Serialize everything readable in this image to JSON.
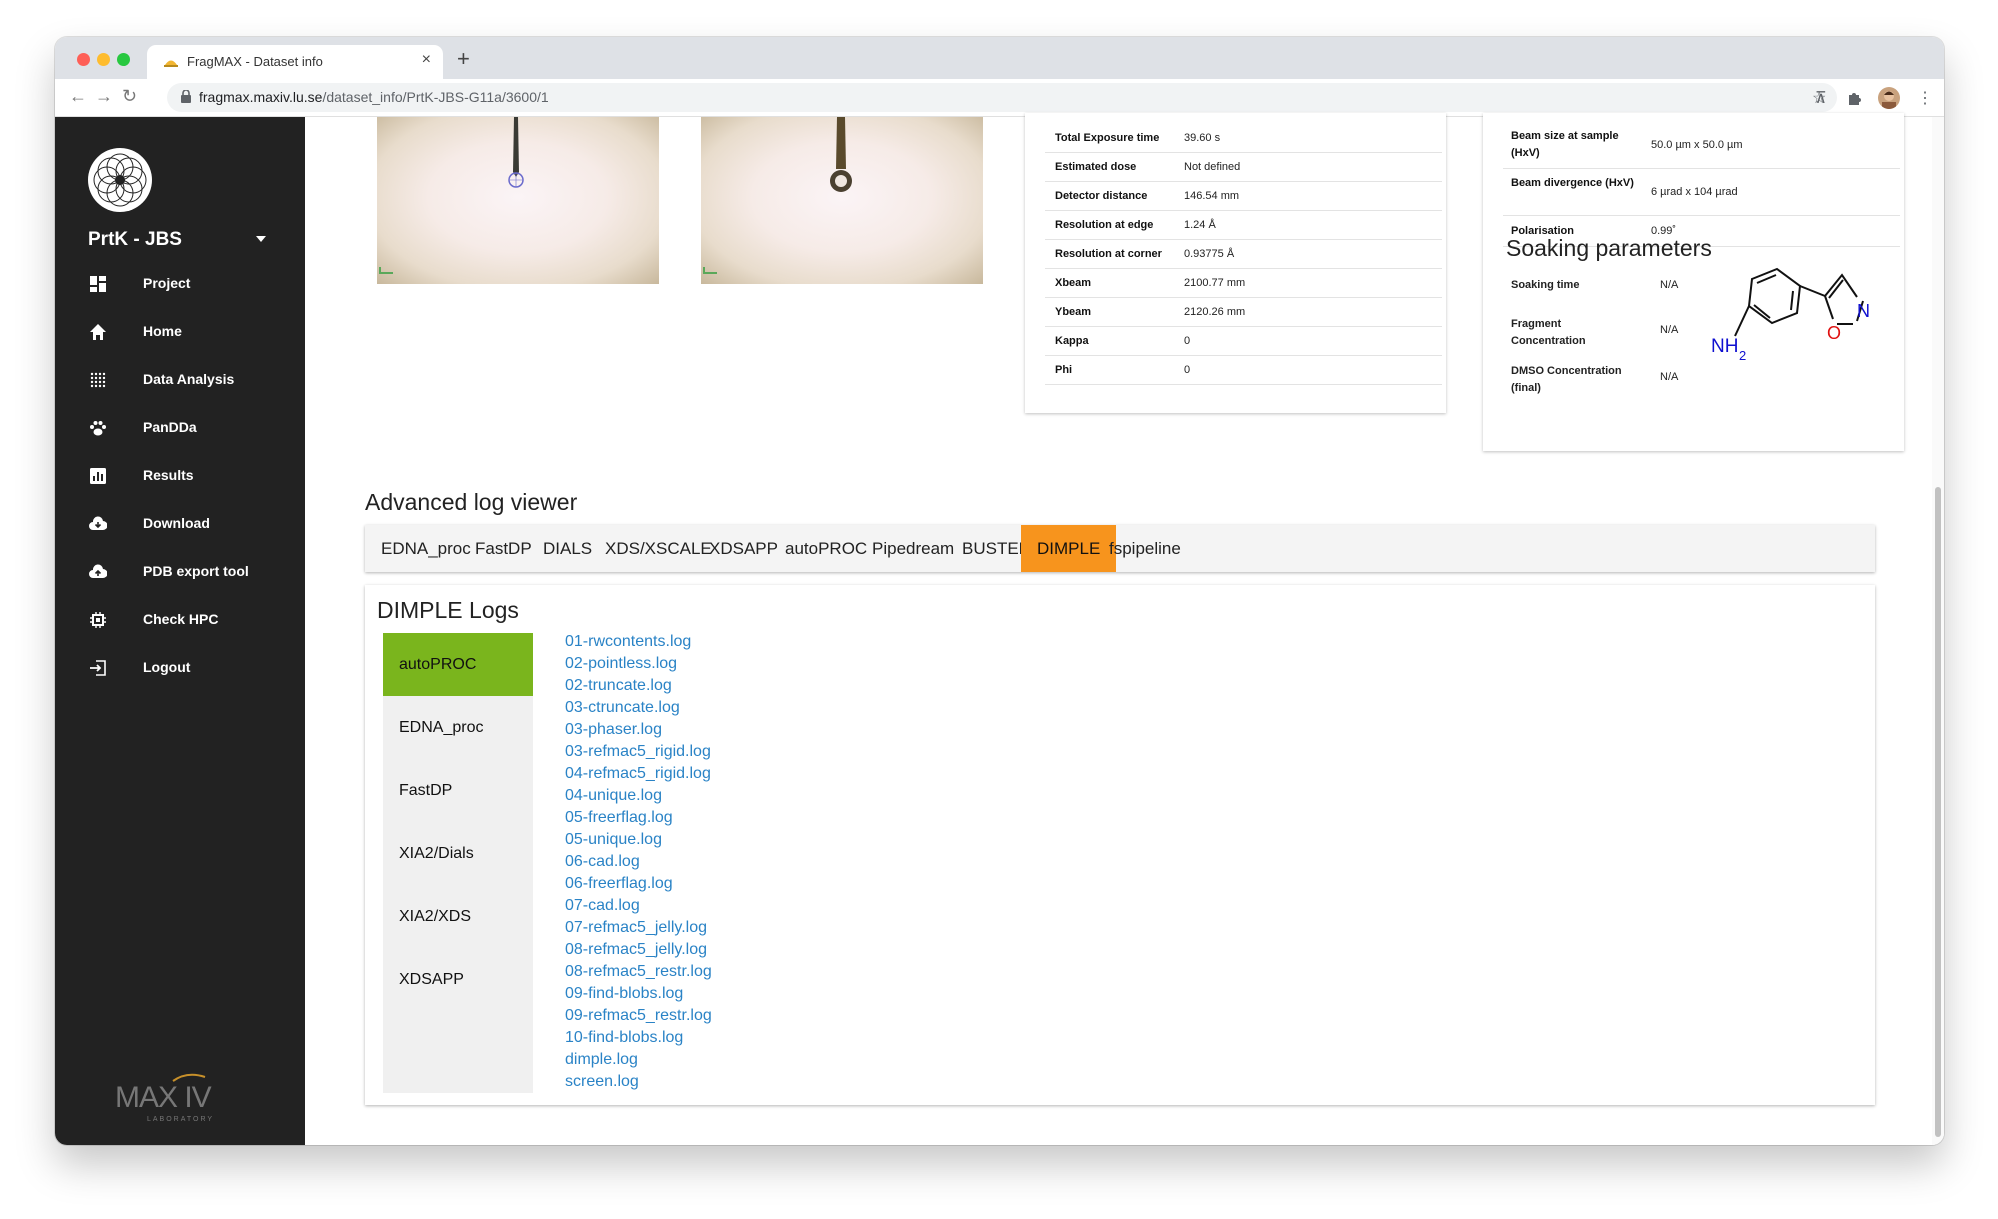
{
  "browser": {
    "tab_title": "FragMAX - Dataset info",
    "url_host": "fragmax.maxiv.lu.se",
    "url_path": "/dataset_info/PrtK-JBS-G11a/3600/1"
  },
  "sidebar": {
    "project": "PrtK - JBS",
    "items": [
      {
        "label": "Project",
        "icon": "dashboard-icon"
      },
      {
        "label": "Home",
        "icon": "home-icon"
      },
      {
        "label": "Data Analysis",
        "icon": "grid-dots-icon"
      },
      {
        "label": "PanDDa",
        "icon": "paw-icon"
      },
      {
        "label": "Results",
        "icon": "bar-chart-icon"
      },
      {
        "label": "Download",
        "icon": "cloud-download-icon"
      },
      {
        "label": "PDB export tool",
        "icon": "cloud-upload-icon"
      },
      {
        "label": "Check HPC",
        "icon": "chip-icon"
      },
      {
        "label": "Logout",
        "icon": "logout-icon"
      }
    ],
    "footer_logo": "MAX IV",
    "footer_sub": "LABORATORY"
  },
  "experiment": {
    "rows": [
      {
        "key": "Total Exposure time",
        "value": "39.60 s"
      },
      {
        "key": "Estimated dose",
        "value": "Not defined"
      },
      {
        "key": "Detector distance",
        "value": "146.54 mm"
      },
      {
        "key": "Resolution at edge",
        "value": "1.24 Å"
      },
      {
        "key": "Resolution at corner",
        "value": "0.93775 Å"
      },
      {
        "key": "Xbeam",
        "value": "2100.77 mm"
      },
      {
        "key": "Ybeam",
        "value": "2120.26 mm"
      },
      {
        "key": "Kappa",
        "value": "0"
      },
      {
        "key": "Phi",
        "value": "0"
      }
    ]
  },
  "beam": {
    "rows": [
      {
        "key": "Beam size at sample (HxV)",
        "value": "50.0 µm x 50.0 µm"
      },
      {
        "key": "Beam divergence (HxV)",
        "value": "6 µrad x 104 µrad"
      },
      {
        "key": "Polarisation",
        "value": "0.99˚"
      }
    ]
  },
  "soaking": {
    "title": "Soaking parameters",
    "rows": [
      {
        "key": "Soaking time",
        "value": "N/A"
      },
      {
        "key": "Fragment Concentration",
        "value": "N/A"
      },
      {
        "key": "DMSO Concentration (final)",
        "value": "N/A"
      }
    ],
    "molecule": {
      "nh": "NH",
      "nh_sub": "2",
      "o": "O",
      "n": "N"
    }
  },
  "log_viewer": {
    "title": "Advanced log viewer",
    "tabs": [
      "EDNA_proc",
      "FastDP",
      "DIALS",
      "XDS/XSCALE",
      "XDSAPP",
      "autoPROC",
      "Pipedream",
      "BUSTER",
      "DIMPLE",
      "fspipeline"
    ],
    "active_tab": "DIMPLE",
    "panel_title": "DIMPLE Logs",
    "sources": [
      "autoPROC",
      "EDNA_proc",
      "FastDP",
      "XIA2/Dials",
      "XIA2/XDS",
      "XDSAPP"
    ],
    "active_source": "autoPROC",
    "logs": [
      "01-rwcontents.log",
      "02-pointless.log",
      "02-truncate.log",
      "03-ctruncate.log",
      "03-phaser.log",
      "03-refmac5_rigid.log",
      "04-refmac5_rigid.log",
      "04-unique.log",
      "05-freerflag.log",
      "05-unique.log",
      "06-cad.log",
      "06-freerflag.log",
      "07-cad.log",
      "07-refmac5_jelly.log",
      "08-refmac5_jelly.log",
      "08-refmac5_restr.log",
      "09-find-blobs.log",
      "09-refmac5_restr.log",
      "10-find-blobs.log",
      "dimple.log",
      "screen.log"
    ]
  },
  "colors": {
    "accent_orange": "#f7941d",
    "accent_green": "#7ab51d",
    "link": "#2a83c6",
    "sidebar": "#222222"
  }
}
